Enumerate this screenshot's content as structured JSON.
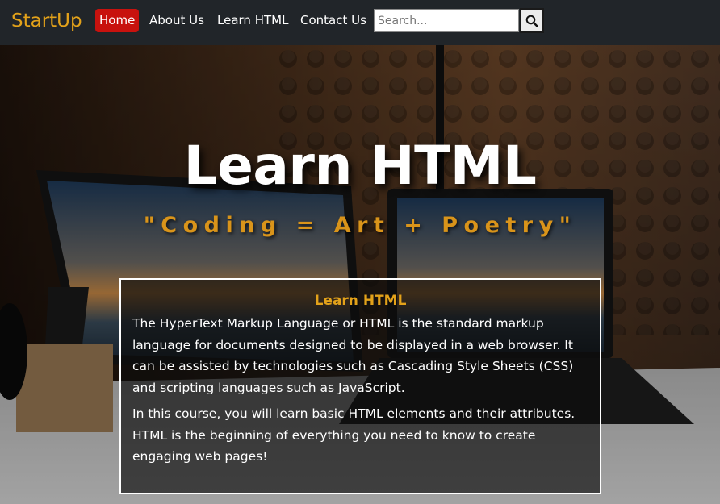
{
  "navbar": {
    "brand": "StartUp",
    "links": [
      {
        "label": "Home",
        "active": true
      },
      {
        "label": "About Us",
        "active": false
      },
      {
        "label": "Learn HTML",
        "active": false
      },
      {
        "label": "Contact Us",
        "active": false
      }
    ],
    "search": {
      "placeholder": "Search...",
      "value": "",
      "icon": "search-icon"
    }
  },
  "hero": {
    "title": "Learn HTML",
    "subtitle": "\"Coding = Art + Poetry\""
  },
  "card": {
    "heading": "Learn HTML",
    "paragraphs": [
      "The HyperText Markup Language or HTML is the standard markup language for documents designed to be displayed in a web browser. It can be assisted by technologies such as Cascading Style Sheets (CSS) and scripting languages such as JavaScript.",
      "In this course, you will learn basic HTML elements and their attributes. HTML is the beginning of everything you need to know to create engaging web pages!"
    ]
  },
  "colors": {
    "navbar_bg": "#212529",
    "brand": "#e3a21a",
    "active_link_bg": "#c8120e",
    "subtitle": "#d9941a"
  }
}
